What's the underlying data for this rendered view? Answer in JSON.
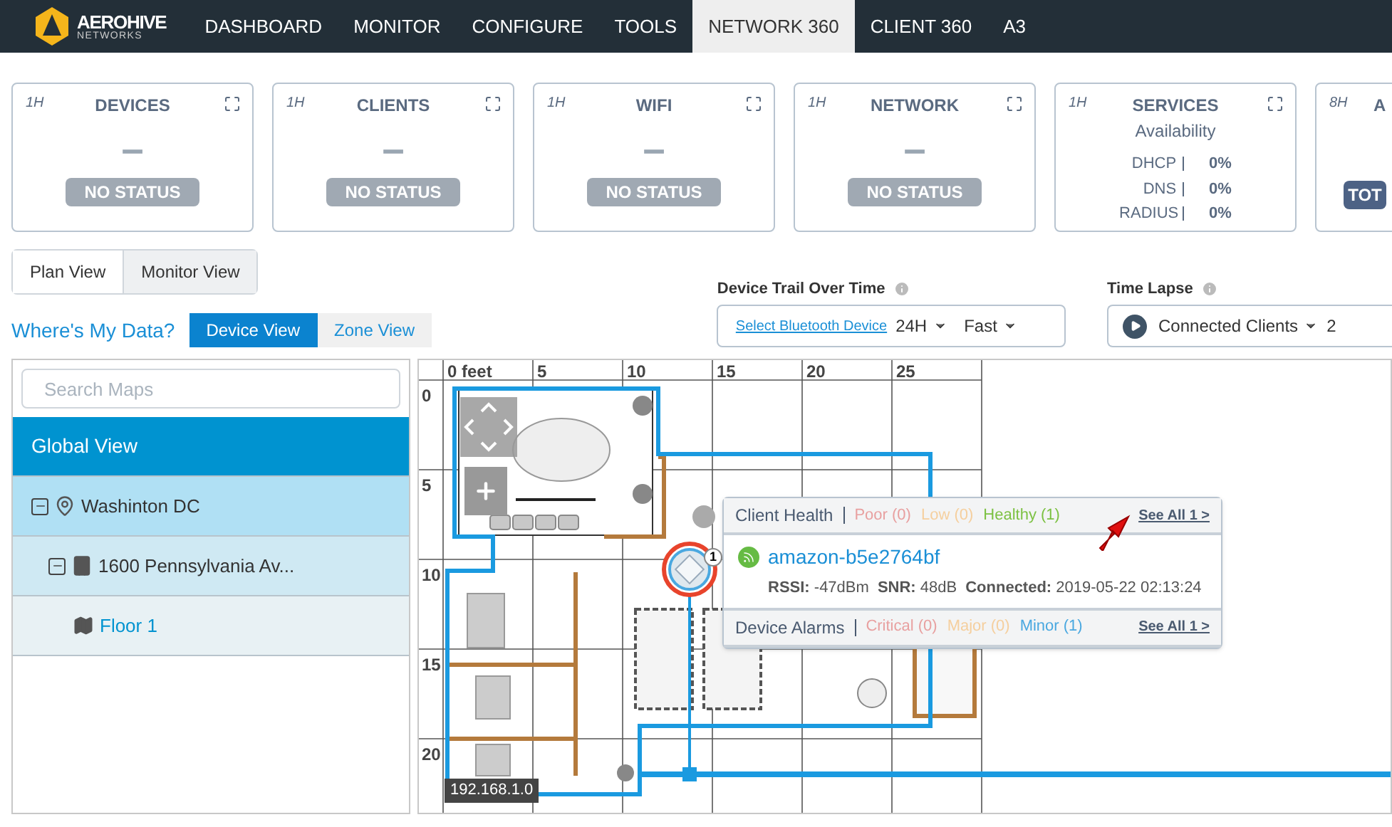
{
  "nav": {
    "brand": "AEROHIVE",
    "brand_sub": "NETWORKS",
    "items": [
      {
        "label": "DASHBOARD",
        "selected": false
      },
      {
        "label": "MONITOR",
        "selected": false
      },
      {
        "label": "CONFIGURE",
        "selected": false
      },
      {
        "label": "TOOLS",
        "selected": false
      },
      {
        "label": "NETWORK 360",
        "selected": true
      },
      {
        "label": "CLIENT 360",
        "selected": false
      },
      {
        "label": "A3",
        "selected": false
      }
    ]
  },
  "cards": [
    {
      "kind": "status",
      "period": "1H",
      "title": "DEVICES",
      "value": "–",
      "status": "NO STATUS"
    },
    {
      "kind": "status",
      "period": "1H",
      "title": "CLIENTS",
      "value": "–",
      "status": "NO STATUS"
    },
    {
      "kind": "status",
      "period": "1H",
      "title": "WIFI",
      "value": "–",
      "status": "NO STATUS"
    },
    {
      "kind": "status",
      "period": "1H",
      "title": "NETWORK",
      "value": "–",
      "status": "NO STATUS"
    },
    {
      "kind": "services",
      "period": "1H",
      "title": "SERVICES",
      "subtitle": "Availability",
      "rows": [
        {
          "label": "DHCP",
          "value": "0%"
        },
        {
          "label": "DNS",
          "value": "0%"
        },
        {
          "label": "RADIUS",
          "value": "0%"
        }
      ]
    },
    {
      "kind": "total",
      "period": "8H",
      "title": "A",
      "button": "TOT"
    }
  ],
  "view_tabs": [
    {
      "label": "Plan View",
      "selected": true
    },
    {
      "label": "Monitor View",
      "selected": false
    }
  ],
  "data_section": {
    "title": "Where's My Data?",
    "tabs": [
      {
        "label": "Device View",
        "selected": true
      },
      {
        "label": "Zone View",
        "selected": false
      }
    ]
  },
  "device_trail": {
    "label": "Device Trail Over Time",
    "link": "Select Bluetooth Device",
    "period": "24H",
    "speed": "Fast"
  },
  "time_lapse": {
    "label": "Time Lapse",
    "selection": "Connected Clients",
    "extra": "2"
  },
  "sidebar": {
    "search_placeholder": "Search Maps",
    "items": [
      {
        "label": "Global View",
        "selected": true,
        "children": [
          {
            "label": "Washinton DC",
            "kind": "location",
            "selected": false,
            "expanded": true,
            "children": [
              {
                "label": "1600 Pennsylvania Av...",
                "kind": "building",
                "selected": false,
                "expanded": true,
                "children": [
                  {
                    "label": "Floor 1",
                    "kind": "floor",
                    "selected": false
                  }
                ]
              }
            ]
          }
        ]
      }
    ]
  },
  "map": {
    "x_labels": [
      "0 feet",
      "5",
      "10",
      "15",
      "20",
      "25"
    ],
    "y_labels": [
      "0",
      "5",
      "10",
      "15",
      "20"
    ],
    "subnet_label": "192.168.1.0",
    "ap_badge": "1"
  },
  "popup": {
    "client_health": {
      "title": "Client Health",
      "levels": [
        {
          "label": "Poor (0)",
          "color": "#e8a0a0"
        },
        {
          "label": "Low (0)",
          "color": "#f5cf9e"
        },
        {
          "label": "Healthy (1)",
          "color": "#7cc142"
        }
      ],
      "see_all": "See All 1 >"
    },
    "client": {
      "name": "amazon-b5e2764bf",
      "rssi_label": "RSSI:",
      "rssi": "-47dBm",
      "snr_label": "SNR:",
      "snr": "48dB",
      "connected_label": "Connected:",
      "connected": "2019-05-22 02:13:24"
    },
    "device_alarms": {
      "title": "Device Alarms",
      "levels": [
        {
          "label": "Critical (0)",
          "color": "#e8a0a0"
        },
        {
          "label": "Major (0)",
          "color": "#f5cf9e"
        },
        {
          "label": "Minor (1)",
          "color": "#4aa8e0"
        }
      ],
      "see_all": "See All 1 >"
    }
  }
}
